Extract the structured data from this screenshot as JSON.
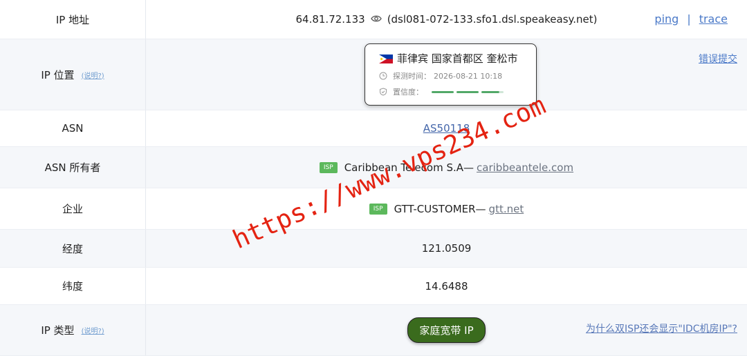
{
  "rows": {
    "ip": {
      "label": "IP 地址",
      "address": "64.81.72.133",
      "hostname": "(dsl081-072-133.sfo1.dsl.speakeasy.net)",
      "ping": "ping",
      "separator": "|",
      "trace": "trace"
    },
    "location": {
      "label": "IP 位置",
      "help": "(说明?)",
      "place": "菲律宾 国家首都区 奎松市",
      "time_label": "探测时间：",
      "time_value": "2026-08-21 10:18",
      "confidence_label": "置信度：",
      "confidence_level": 0.93,
      "report_error": "错误提交"
    },
    "asn": {
      "label": "ASN",
      "value": "AS50118"
    },
    "asn_owner": {
      "label": "ASN 所有者",
      "badge": "ISP",
      "name": "Caribbean Telecom S.A—",
      "domain": "caribbeantele.com"
    },
    "enterprise": {
      "label": "企业",
      "badge": "ISP",
      "name": "GTT-CUSTOMER—",
      "domain": "gtt.net"
    },
    "longitude": {
      "label": "经度",
      "value": "121.0509"
    },
    "latitude": {
      "label": "纬度",
      "value": "14.6488"
    },
    "ip_type": {
      "label": "IP 类型",
      "help": "(说明?)",
      "value": "家庭宽带 IP",
      "question": "为什么双ISP还会显示\"IDC机房IP\"?"
    }
  },
  "watermark": "https://www.vps234.com",
  "colors": {
    "link": "#4466aa",
    "badge_green": "#5cb85c",
    "type_button": "#3a6b1d",
    "watermark": "#e42312",
    "confidence": "#52a868"
  },
  "icons": [
    "eye-icon",
    "philippines-flag-icon",
    "clock-icon",
    "shield-check-icon"
  ]
}
